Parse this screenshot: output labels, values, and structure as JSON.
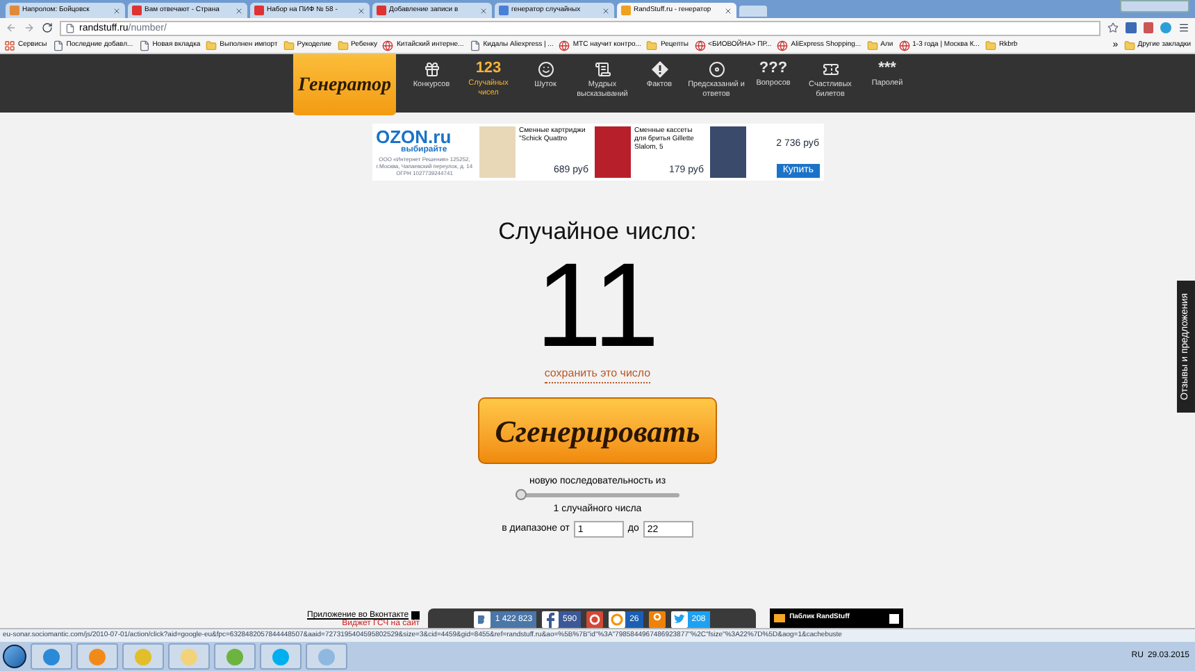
{
  "browser": {
    "tabs": [
      {
        "title": "Напролом: Бойцовск",
        "kind": "page",
        "selected": false
      },
      {
        "title": "Вам отвечают - Страна",
        "kind": "site",
        "selected": false
      },
      {
        "title": "Набор на ПИФ № 58 -",
        "kind": "site",
        "selected": false
      },
      {
        "title": "Добавление записи в",
        "kind": "site",
        "selected": false
      },
      {
        "title": "генератор случайных",
        "kind": "search",
        "selected": false
      },
      {
        "title": "RandStuff.ru - генератор",
        "kind": "rand",
        "selected": true
      }
    ],
    "address": {
      "host": "randstuff.ru",
      "path": "/number/"
    },
    "bookmarks": [
      {
        "label": "Сервисы",
        "kind": "apps"
      },
      {
        "label": "Последние добавл...",
        "kind": "page"
      },
      {
        "label": "Новая вкладка",
        "kind": "page"
      },
      {
        "label": "Выполнен импорт",
        "kind": "folder"
      },
      {
        "label": "Рукоделие",
        "kind": "folder"
      },
      {
        "label": "Ребенку",
        "kind": "folder"
      },
      {
        "label": "Китайский интерне...",
        "kind": "site"
      },
      {
        "label": "Кидалы Aliexpress | ...",
        "kind": "page"
      },
      {
        "label": "МТС научит контро...",
        "kind": "site"
      },
      {
        "label": "Рецепты",
        "kind": "folder"
      },
      {
        "label": "<БИОВОЙНА> ПР...",
        "kind": "site"
      },
      {
        "label": "AliExpress Shopping...",
        "kind": "site"
      },
      {
        "label": "Али",
        "kind": "folder"
      },
      {
        "label": "1-3 года | Москва К...",
        "kind": "site"
      },
      {
        "label": "Rkbrb",
        "kind": "folder"
      }
    ],
    "more_bookmarks": "»",
    "other_bookmarks": "Другие закладки"
  },
  "nav": {
    "logo": "Генератор",
    "items": [
      {
        "label": "Конкурсов",
        "kind": "gift",
        "selected": false
      },
      {
        "label": "Случайных чисел",
        "kind": "glyph",
        "glyph": "123",
        "selected": true
      },
      {
        "label": "Шуток",
        "kind": "smiley",
        "selected": false
      },
      {
        "label": "Мудрых высказываний",
        "kind": "scroll",
        "selected": false
      },
      {
        "label": "Фактов",
        "kind": "diamond",
        "selected": false
      },
      {
        "label": "Предсказаний и ответов",
        "kind": "disc",
        "selected": false
      },
      {
        "label": "Вопросов",
        "kind": "glyph",
        "glyph": "???",
        "selected": false
      },
      {
        "label": "Счастливых билетов",
        "kind": "ticket",
        "selected": false
      },
      {
        "label": "Паролей",
        "kind": "glyph",
        "glyph": "***",
        "selected": false
      }
    ]
  },
  "ad": {
    "logo": "OZON.ru",
    "slogan": "выбирайте",
    "legal": "ООО «Интернет Решения» 125252, г.Москва, Чапаевский переулок, д. 14 ОГРН 1027739244741",
    "products": [
      {
        "name": "Сменные картриджи \"Schick Quattro",
        "price": "689",
        "currency": "руб"
      },
      {
        "name": "Сменные кассеты для бритья Gillette Slalom, 5",
        "price": "179",
        "currency": "руб"
      },
      {
        "price": "2 736",
        "currency": "руб",
        "button": "Купить"
      }
    ]
  },
  "generator": {
    "title": "Случайное число:",
    "result": "11",
    "save_link": "сохранить это число",
    "button": "Сгенерировать",
    "sequence_label": "новую последовательность из",
    "sequence": {
      "level": 0.0
    },
    "count_label": "1 случайного числа",
    "range_from_label": "в диапазоне от",
    "from": "1",
    "range_to_label": "до",
    "to": "22"
  },
  "feedback_tab": "Отзывы и предложения",
  "footer": {
    "vk_app": "Приложение во Вконтакте",
    "widget": "Виджет ГСЧ на сайт",
    "shares": [
      {
        "kind": "vk",
        "count": "1 422 823"
      },
      {
        "kind": "facebook",
        "count": "590"
      },
      {
        "kind": "gplus"
      },
      {
        "kind": "mail",
        "count": "26"
      },
      {
        "kind": "ok"
      },
      {
        "kind": "twitter",
        "count": "208"
      }
    ],
    "public": "Паблик RandStuff"
  },
  "status_url": "eu-sonar.sociomantic.com/js/2010-07-01/action/click?aid=google-eu&fpc=6328482057844448507&aaid=7273195404595802529&size=3&cid=4459&gid=8455&ref=randstuff.ru&ao=%5B%7B\"id\"%3A\"7985844967486923877\"%2C\"fsize\"%3A22%7D%5D&aog=1&cachebuste",
  "taskbar": {
    "language": "RU",
    "date": "29.03.2015"
  }
}
